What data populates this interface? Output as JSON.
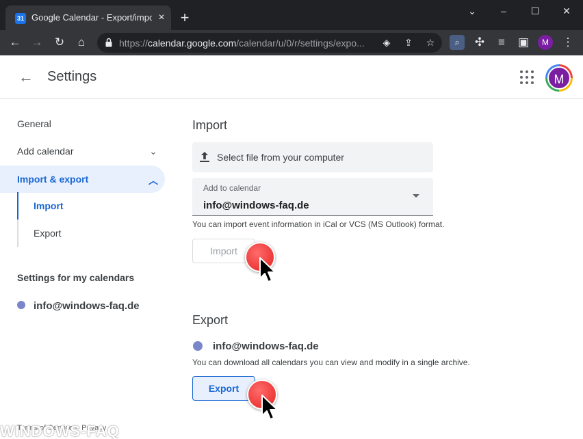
{
  "browser": {
    "tab_title": "Google Calendar - Export/import",
    "favicon_text": "31",
    "url_prefix": "https://",
    "url_host": "calendar.google.com",
    "url_path": "/calendar/u/0/r/settings/expo...",
    "profile_initial": "M"
  },
  "header": {
    "title": "Settings",
    "avatar_initial": "M"
  },
  "sidebar": {
    "items": [
      {
        "label": "General"
      },
      {
        "label": "Add calendar"
      },
      {
        "label": "Import & export"
      }
    ],
    "sub_items": [
      {
        "label": "Import"
      },
      {
        "label": "Export"
      }
    ],
    "section_heading": "Settings for my calendars",
    "calendar_name": "info@windows-faq.de",
    "footer": "Terms of Service – Privacy"
  },
  "import": {
    "title": "Import",
    "file_button_label": "Select file from your computer",
    "add_to_calendar_caption": "Add to calendar",
    "selected_calendar": "info@windows-faq.de",
    "hint": "You can import event information in iCal or VCS (MS Outlook) format.",
    "button_label": "Import"
  },
  "export": {
    "title": "Export",
    "calendar_name": "info@windows-faq.de",
    "hint": "You can download all calendars you can view and modify in a single archive.",
    "button_label": "Export"
  },
  "watermark": "WINDOWS-FAQ",
  "colors": {
    "accent": "#1967d2",
    "active_bg": "#e8f0fe",
    "calendar_dot": "#7986cb",
    "avatar": "#7b1fa2",
    "chrome_dark": "#202124"
  }
}
